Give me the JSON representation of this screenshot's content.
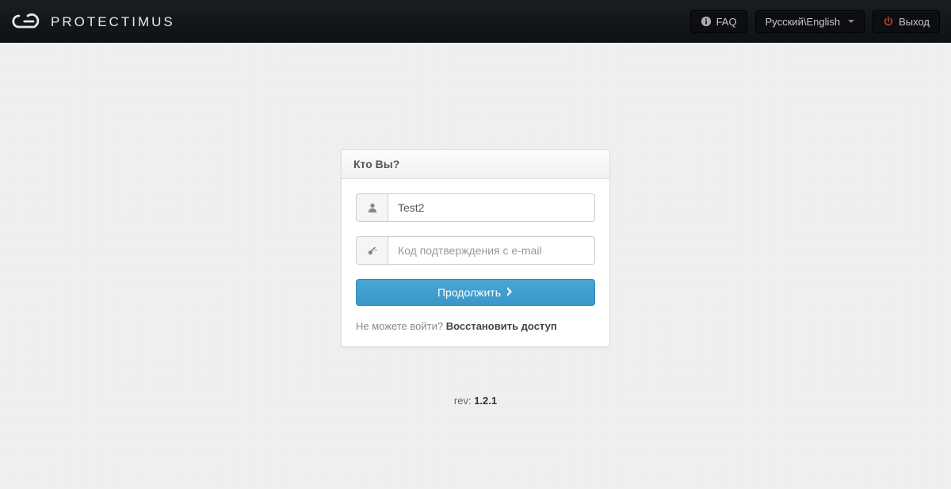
{
  "brand": {
    "name": "PROTECTIMUS"
  },
  "nav": {
    "faq_label": "FAQ",
    "language_label": "Русский\\English",
    "logout_label": "Выход"
  },
  "panel": {
    "title": "Кто Вы?",
    "username_value": "Test2",
    "code_placeholder": "Код подтверждения с e-mail",
    "submit_label": "Продолжить",
    "recover_prefix": "Не можете войти? ",
    "recover_link": "Восстановить доступ"
  },
  "footer": {
    "rev_label": "rev: ",
    "rev_value": "1.2.1"
  }
}
